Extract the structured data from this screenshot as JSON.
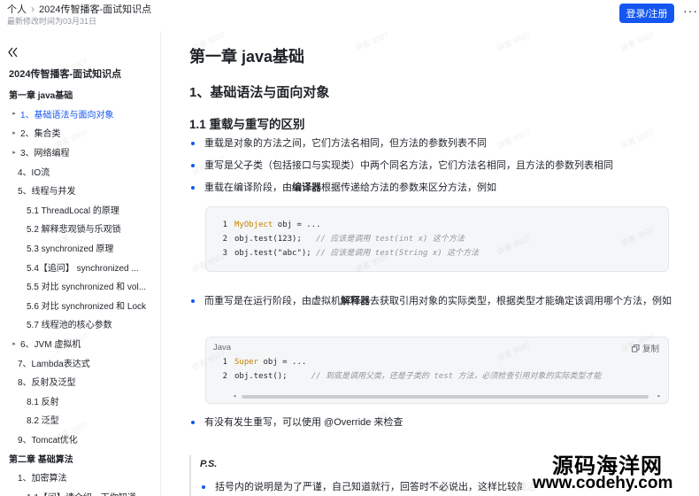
{
  "header": {
    "breadcrumb_root": "个人",
    "breadcrumb_doc": "2024传智播客-面试知识点",
    "modified": "最新修改时间为03月31日",
    "login_label": "登录/注册",
    "more_label": "···"
  },
  "sidebar": {
    "title": "2024传智播客-面试知识点",
    "items": [
      {
        "label": "第一章 java基础",
        "arrow": "",
        "bold": true
      },
      {
        "label": "1、基础语法与面向对象",
        "arrow": "▸",
        "active": true
      },
      {
        "label": "2、集合类",
        "arrow": "▸"
      },
      {
        "label": "3、网络编程",
        "arrow": "▸"
      },
      {
        "label": "4、IO流",
        "arrow": ""
      },
      {
        "label": "5、线程与并发",
        "arrow": ""
      },
      {
        "label": "5.1 ThreadLocal 的原理",
        "arrow": ""
      },
      {
        "label": "5.2 解释悲观锁与乐观锁",
        "arrow": ""
      },
      {
        "label": "5.3 synchronized 原理",
        "arrow": ""
      },
      {
        "label": "5.4【追问】 synchronized ...",
        "arrow": ""
      },
      {
        "label": "5.5 对比 synchronized 和 vol...",
        "arrow": ""
      },
      {
        "label": "5.6 对比 synchronized 和 Lock",
        "arrow": ""
      },
      {
        "label": "5.7 线程池的核心参数",
        "arrow": ""
      },
      {
        "label": "6、JVM 虚拟机",
        "arrow": "▸"
      },
      {
        "label": "7、Lambda表达式",
        "arrow": ""
      },
      {
        "label": "8、反射及泛型",
        "arrow": ""
      },
      {
        "label": "8.1 反射",
        "arrow": ""
      },
      {
        "label": "8.2 泛型",
        "arrow": ""
      },
      {
        "label": "9、Tomcat优化",
        "arrow": ""
      },
      {
        "label": "第二章 基础算法",
        "arrow": "",
        "bold": true
      },
      {
        "label": "1、加密算法",
        "arrow": ""
      },
      {
        "label": "1.1【问】请介绍一下你知道",
        "arrow": ""
      }
    ]
  },
  "content": {
    "chapter": "第一章 java基础",
    "section": "1、基础语法与面向对象",
    "subsection": "1.1 重载与重写的区别",
    "bullet1": "重载是对象的方法之间，它们方法名相同，但方法的参数列表不同",
    "bullet2": "重写是父子类（包括接口与实现类）中两个同名方法，它们方法名相同，且方法的参数列表相同",
    "bullet3_pre": "重载在编译阶段，由",
    "bullet3_bold": "编译器",
    "bullet3_post": "根据传递给方法的参数来区分方法，例如",
    "code1": [
      {
        "n": "1",
        "type": "MyObject",
        "rest": " obj = ...",
        "comment": ""
      },
      {
        "n": "2",
        "type": "",
        "rest": "obj.test(123);   ",
        "comment": "// 应该是调用 test(int x) 这个方法"
      },
      {
        "n": "3",
        "type": "",
        "rest": "obj.test(\"abc\"); ",
        "comment": "// 应该是调用 test(String x) 这个方法"
      }
    ],
    "bullet4_pre": "而重写是在运行阶段，由虚拟机",
    "bullet4_bold": "解释器",
    "bullet4_post": "去获取引用对象的实际类型，根据类型才能确定该调用哪个方法，例如",
    "code2_lang": "Java",
    "code2_copy": "复制",
    "code2": [
      {
        "n": "1",
        "type": "Super",
        "rest": " obj = ...",
        "comment": ""
      },
      {
        "n": "2",
        "type": "",
        "rest": "obj.test();     ",
        "comment": "// 到底是调用父类，还是子类的 test 方法，必须检查引用对象的实际类型才能"
      }
    ],
    "bullet5": "有没有发生重写，可以使用 @Override 来检查",
    "ps_title": "P.S.",
    "ps_bullet": "括号内的说明是为了严谨，自己知道就行，回答时不必说出，这样比较简洁"
  },
  "watermark": "讲客 9507",
  "brand": {
    "name": "源码海洋网",
    "url": "www.codehy.com"
  },
  "colors": {
    "accent": "#1456f0",
    "code_type": "#c18401",
    "comment": "#8f959e"
  }
}
